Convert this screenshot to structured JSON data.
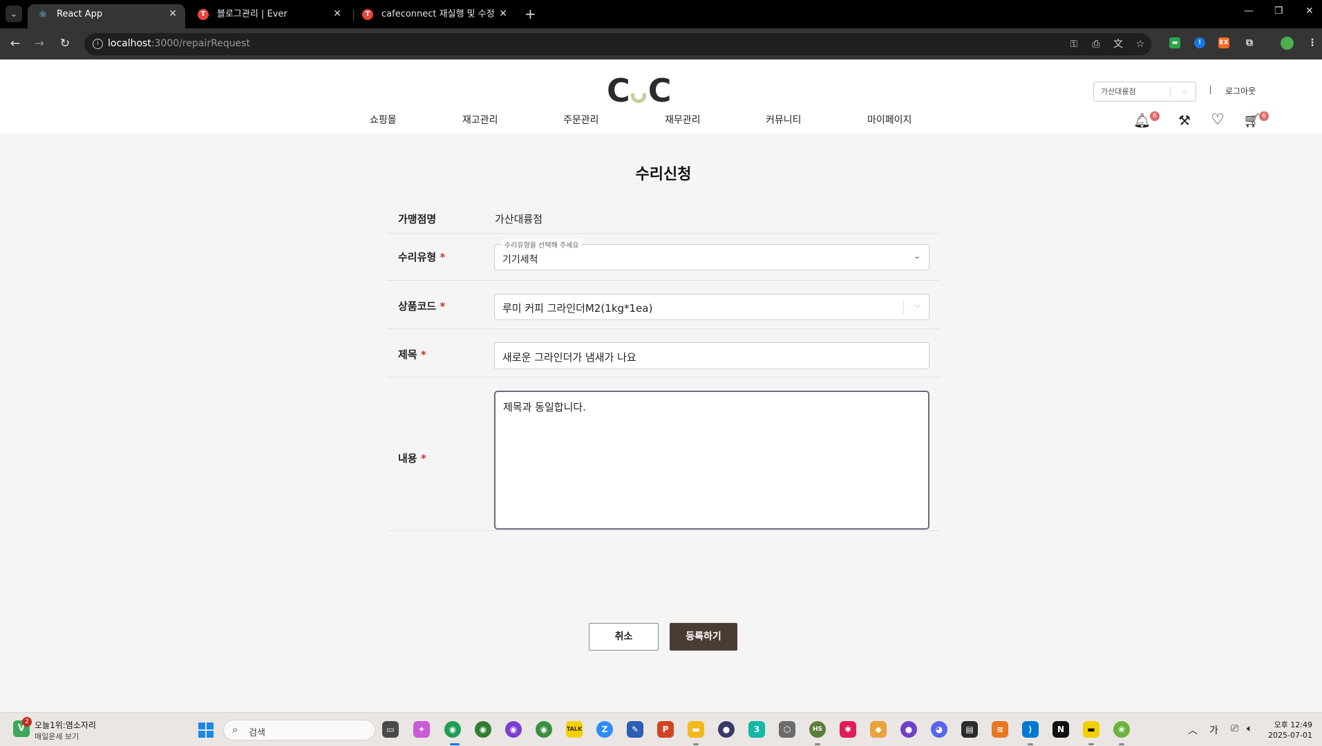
{
  "browser": {
    "tabs": [
      {
        "label": "React App",
        "active": true
      },
      {
        "label": "블로그관리 | Ever",
        "active": false
      },
      {
        "label": "cafeconnect 재실행 및 수정",
        "active": false
      }
    ],
    "url_host": "localhost",
    "url_path": ":3000/repairRequest"
  },
  "header": {
    "logo_left": "C",
    "logo_right": "C",
    "store_select": "가산대륭점",
    "logout": "로그아웃",
    "nav": [
      "쇼핑몰",
      "재고관리",
      "주문관리",
      "재무관리",
      "커뮤니티",
      "마이페이지"
    ],
    "notification_count": "6",
    "cart_count": "6"
  },
  "form": {
    "title": "수리신청",
    "store_label": "가맹점명",
    "store_value": "가산대륭점",
    "repair_type_label": "수리유형",
    "repair_type_legend": "수리유형을 선택해 주세요",
    "repair_type_value": "기기세척",
    "product_label": "상품코드",
    "product_value": "루미 커피 그라인더M2(1kg*1ea)",
    "subject_label": "제목",
    "subject_value": "새로운 그라인더가 냄새가 나요",
    "content_label": "내용",
    "content_value": "제목과 동일합니다.",
    "required_mark": "*",
    "cancel": "취소",
    "submit": "등록하기"
  },
  "taskbar": {
    "widget_badge": "2",
    "widget_line1": "오늘1위:염소자리",
    "widget_line2": "매일운세 보기",
    "search_placeholder": "검색",
    "ime": "가",
    "time": "오후 12:49",
    "date": "2025-07-01"
  }
}
